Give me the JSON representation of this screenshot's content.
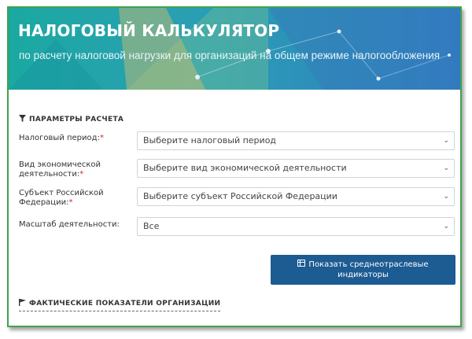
{
  "banner": {
    "title": "НАЛОГОВЫЙ КАЛЬКУЛЯТОР",
    "subtitle": "по расчету налоговой нагрузки для организаций на общем режиме налогообложения"
  },
  "params_section": {
    "title": "ПАРАМЕТРЫ РАСЧЕТА",
    "icon": "filter-icon"
  },
  "fields": [
    {
      "label": "Налоговый период:",
      "required": true,
      "value": "Выберите налоговый период"
    },
    {
      "label_line1": "Вид экономической",
      "label_line2": "деятельности:",
      "required": true,
      "value": "Выберите вид экономической деятельности"
    },
    {
      "label_line1": "Субъект Российской",
      "label_line2": "Федерации:",
      "required": true,
      "value": "Выберите субъект Российской Федерации"
    },
    {
      "label": "Масштаб деятельности:",
      "required": false,
      "value": "Все"
    }
  ],
  "required_mark": "*",
  "show_button": {
    "line1": "Показать среднеотраслевые",
    "line2": "индикаторы",
    "icon": "table-icon"
  },
  "facts_section": {
    "title": "ФАКТИЧЕСКИЕ ПОКАЗАТЕЛИ ОРГАНИЗАЦИИ",
    "icon": "flag-icon"
  },
  "colors": {
    "frame_border": "#3fa34d",
    "banner_left": "#1ba9a1",
    "banner_right": "#2f7fc4",
    "button": "#1d5b93",
    "required": "#d62828"
  }
}
